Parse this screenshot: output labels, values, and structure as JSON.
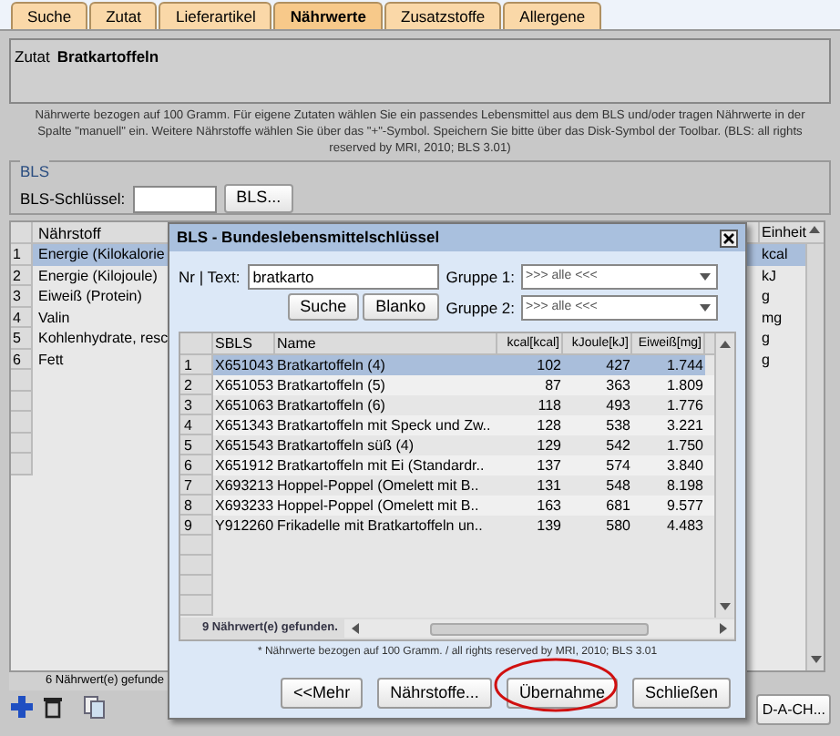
{
  "tabs": [
    {
      "label": "Suche",
      "selected": false
    },
    {
      "label": "Zutat",
      "selected": false
    },
    {
      "label": "Lieferartikel",
      "selected": false
    },
    {
      "label": "Nährwerte",
      "selected": true
    },
    {
      "label": "Zusatzstoffe",
      "selected": false
    },
    {
      "label": "Allergene",
      "selected": false
    }
  ],
  "zutat": {
    "label": "Zutat",
    "name": "Bratkartoffeln"
  },
  "note": "Nährwerte bezogen auf 100 Gramm. Für eigene Zutaten wählen Sie ein passendes Lebensmittel aus dem BLS und/oder tragen Nährwerte in der Spalte \"manuell\" ein. Weitere Nährstoffe wählen Sie über das \"+\"-Symbol. Speichern Sie bitte über das Disk-Symbol der Toolbar. (BLS: all rights reserved by MRI, 2010; BLS 3.01)",
  "bls": {
    "legend": "BLS",
    "key_label": "BLS-Schlüssel:",
    "button": "BLS..."
  },
  "nutrients": {
    "columns": [
      "Nährstoff",
      "Einheit"
    ],
    "rows": [
      {
        "num": "1",
        "name": "Energie (Kilokalorie",
        "unit": "kcal",
        "selected": true
      },
      {
        "num": "2",
        "name": "Energie (Kilojoule)",
        "unit": "kJ",
        "selected": false
      },
      {
        "num": "3",
        "name": "Eiweiß (Protein)",
        "unit": "g",
        "selected": false
      },
      {
        "num": "4",
        "name": "Valin",
        "unit": "mg",
        "selected": false
      },
      {
        "num": "5",
        "name": "Kohlenhydrate, resc",
        "unit": "g",
        "selected": false
      },
      {
        "num": "6",
        "name": "Fett",
        "unit": "g",
        "selected": false
      }
    ],
    "status": "6  Nährwert(e) gefunde"
  },
  "dach_button": "D-A-CH...",
  "dialog": {
    "title": "BLS - Bundeslebensmittelschlüssel",
    "text_label": "Nr | Text:",
    "text_value": "bratkarto",
    "search_button": "Suche",
    "blank_button": "Blanko",
    "groups": [
      {
        "label": "Gruppe 1:",
        "value": ">>> alle <<<"
      },
      {
        "label": "Gruppe 2:",
        "value": ">>> alle <<<"
      }
    ],
    "table": {
      "columns": [
        "SBLS",
        "Name",
        "kcal[kcal]",
        "kJoule[kJ]",
        "Eiweiß[mg]"
      ],
      "rows": [
        {
          "num": "1",
          "cells": [
            "X651043",
            "Bratkartoffeln (4)",
            "102",
            "427",
            "1.744"
          ],
          "selected": true
        },
        {
          "num": "2",
          "cells": [
            "X651053",
            "Bratkartoffeln (5)",
            "87",
            "363",
            "1.809"
          ],
          "selected": false
        },
        {
          "num": "3",
          "cells": [
            "X651063",
            "Bratkartoffeln (6)",
            "118",
            "493",
            "1.776"
          ],
          "selected": false
        },
        {
          "num": "4",
          "cells": [
            "X651343",
            "Bratkartoffeln mit Speck und Zw..",
            "128",
            "538",
            "3.221"
          ],
          "selected": false
        },
        {
          "num": "5",
          "cells": [
            "X651543",
            "Bratkartoffeln süß (4)",
            "129",
            "542",
            "1.750"
          ],
          "selected": false
        },
        {
          "num": "6",
          "cells": [
            "X651912",
            "Bratkartoffeln mit Ei (Standardr..",
            "137",
            "574",
            "3.840"
          ],
          "selected": false
        },
        {
          "num": "7",
          "cells": [
            "X693213",
            "Hoppel-Poppel (Omelett mit B..",
            "131",
            "548",
            "8.198"
          ],
          "selected": false
        },
        {
          "num": "8",
          "cells": [
            "X693233",
            "Hoppel-Poppel (Omelett mit B..",
            "163",
            "681",
            "9.577"
          ],
          "selected": false
        },
        {
          "num": "9",
          "cells": [
            "Y912260",
            "Frikadelle mit Bratkartoffeln un..",
            "139",
            "580",
            "4.483"
          ],
          "selected": false
        }
      ],
      "status": "9  Nährwert(e) gefunden."
    },
    "footnote": "* Nährwerte bezogen auf 100 Gramm. / all rights reserved by MRI, 2010; BLS 3.01",
    "buttons": [
      {
        "label": "<<Mehr",
        "circled": false
      },
      {
        "label": "Nährstoffe...",
        "circled": false
      },
      {
        "label": "Übernahme",
        "circled": true
      },
      {
        "label": "Schließen",
        "circled": false
      }
    ]
  }
}
